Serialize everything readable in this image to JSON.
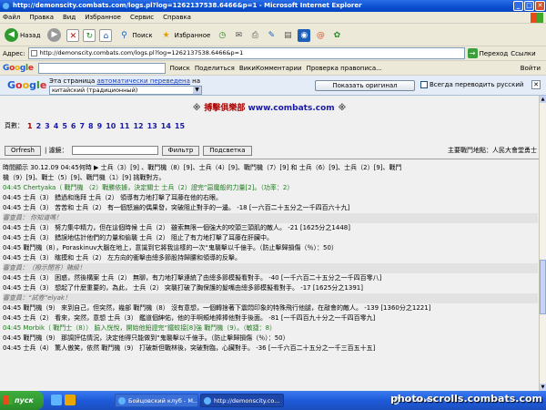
{
  "window": {
    "title": "http://demonscity.combats.com/logs.pl?log=1262137538.6466&p=1 - Microsoft Internet Explorer",
    "min": "_",
    "max": "□",
    "close": "✕"
  },
  "menu": [
    "Файл",
    "Правка",
    "Вид",
    "Избранное",
    "Сервис",
    "Справка"
  ],
  "toolbar": {
    "back": "Назад",
    "search": "Поиск",
    "favorites": "Избранное"
  },
  "address": {
    "label": "Адрес:",
    "url": "http://demonscity.combats.com/logs.pl?log=1262137538.6466&p=1",
    "go": "Переход",
    "links": "Ссылки"
  },
  "google_toolbar": {
    "logo": "Google",
    "search": "Поиск",
    "share": "Поделиться",
    "comments": "ВикиКомментарии",
    "spell": "Проверка правописа...",
    "signin": "Войти"
  },
  "translate": {
    "logo": "Google",
    "message_before": "Эта страница ",
    "message_link": "автоматически переведена",
    "message_after": " на",
    "language": "китайский (традиционный)",
    "show_original": "Показать оригинал",
    "always": "Всегда переводить русский",
    "close": "✕"
  },
  "banner": {
    "cn": "搏擊俱樂部",
    "url": "www.combats.com"
  },
  "pages": {
    "label": "頁數：",
    "current": "1",
    "numbers": [
      "2",
      "3",
      "4",
      "5",
      "6",
      "7",
      "8",
      "9",
      "10",
      "11",
      "12",
      "13",
      "14",
      "15"
    ]
  },
  "controls": {
    "refresh": "Orfresh",
    "filter_label": "| 濾鏡：",
    "filter": "Фильтр",
    "highlight": "Подсветка",
    "battle_place": "主要戰鬥地點：人民大會堂勇士"
  },
  "log": {
    "line1": "時間顯示 30.12.09 04:45何時 ▶ 士兵（3）[9] 、戰鬥機（8）[9]、士兵（4）[9]、戰鬥機（7）[9] 和 士兵（6）[9]、士兵（2）[9]、戰鬥",
    "line2": "機（9）[9]、戰士（5）[9]、戰鬥機（1）[9] 挑戰對方。",
    "line3": "04:45 Chertyaka（ 戰鬥機 （2）戰勝依據，決定關士 士兵（2）證完“惡魔般的力量[2]。（功率：2）",
    "line4": "04:45 士兵（3） 錯過和逸拜 士兵（2） 領導有力地打擊了耳藤在他的右眼。",
    "line5": "04:45 士兵（3） 苦苦和 士兵（2） 有一個怒遍的偶果發，突破阻止對手的一邊。 -18 [一六百二十五分之一千四百六十九]",
    "line6": "審查員： 你知道嗎！",
    "line7": "04:45 士兵（3） 努力集中精力，但在這個時候 士兵（2） 雖索無限一個強大的咬頭三頭肌的敵人。 -21 [1625分之1448]",
    "line8": "04:45 士兵（3） 錯誤地估計他們的力量和偷襲 士兵（2） 阻止了有力地打擊了耳藤在肝臟中。",
    "line9": "04:45 戰鬥機（8），Poraskinuv大腦在地上，意識到它將我這樣的一次“鬼襲擊以千億手。（防止擊歸損傷（％）：50）",
    "line10": "04:45 士兵（3） 瞎摸和 士兵（2） 左方向的衝擊由總多節股持歸腰和領導的反擊。",
    "line11": "審查員：（撥示閉答）賭級！",
    "line12": "04:45 士兵（3） 困惑，然後構案 士兵（2） 無聊，有力地打擊連統了由總多節模擬看對手。 -40 [一千六百二十五分之一千四百零八]",
    "line13": "04:45 士兵（3） 想起了什麼重要的，為此， 士兵（2） 突襲打破了胸保護的髮嘴由總多節模擬看對手。 -17 [1625分之1391]",
    "line14": "審查員：“試卷”elyak！",
    "line15": "04:45 戰鬥機（9） 來到自己，但突然，幾部 戰鬥機（8） 沒有意想，一個轉捨著下震悶印象的特殊飛行他腿，在敲會的敵人。 -139 [1360分之1221]",
    "line16": "04:45 士兵（2） 看來，突然，意想 士兵（3） 鑑道個紳佑，他的手啊頰地捧捧他對手後面。 -81 [一千四百九十分之一千四百零九]",
    "line17": "04:45 Morbik（ 戰鬥士（8）） 臉入恍悅，開始他鉛證完“鐵蛟接[8]強 戰鬥機（9）。（敏捷：8）",
    "line18": "04:45 戰鬥機（9） 那調評估情況，決定他得只能做到“鬼襲擊以千億手。（防止擊歸損傷（％）：50）",
    "line19": "04:45 士兵（4） 驚人傲笑，依然 戰鬥機（9） 打破新但戰林後，突破對臨，心臟對手。 -36 [一千六百二十五分之一千三百五十五]"
  },
  "taskbar": {
    "start": "пуск",
    "task1": "Бойцовский клуб - M...",
    "task2": "http://demonscity.co...",
    "status": "Интернет",
    "watermark": "photo.scrolls.combats.com"
  }
}
